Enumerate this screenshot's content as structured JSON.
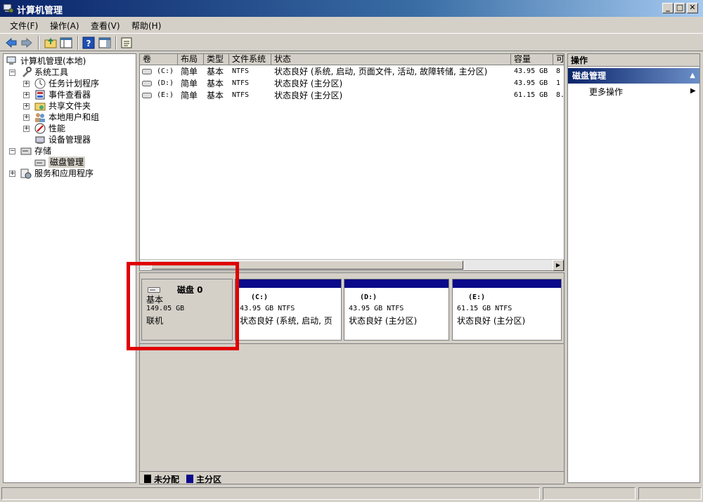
{
  "window": {
    "title": "计算机管理",
    "minimize": "_",
    "maximize": "□",
    "close": "✕"
  },
  "menu": [
    "文件(F)",
    "操作(A)",
    "查看(V)",
    "帮助(H)"
  ],
  "tree": [
    {
      "label": "计算机管理(本地)",
      "icon": "computer-icon"
    },
    {
      "label": "系统工具",
      "icon": "tools-icon",
      "expander": "−"
    },
    {
      "label": "任务计划程序",
      "icon": "clock-icon",
      "expander": "+"
    },
    {
      "label": "事件查看器",
      "icon": "event-viewer-icon",
      "expander": "+"
    },
    {
      "label": "共享文件夹",
      "icon": "shared-folder-icon",
      "expander": "+"
    },
    {
      "label": "本地用户和组",
      "icon": "users-icon",
      "expander": "+"
    },
    {
      "label": "性能",
      "icon": "performance-icon",
      "expander": "+"
    },
    {
      "label": "设备管理器",
      "icon": "device-manager-icon"
    },
    {
      "label": "存储",
      "icon": "storage-icon",
      "expander": "−"
    },
    {
      "label": "磁盘管理",
      "icon": "disk-management-icon",
      "selected": true
    },
    {
      "label": "服务和应用程序",
      "icon": "services-icon",
      "expander": "+"
    }
  ],
  "volume_columns": [
    "卷",
    "布局",
    "类型",
    "文件系统",
    "状态",
    "容量",
    "可"
  ],
  "volumes": [
    {
      "name": "(C:)",
      "layout": "简单",
      "type": "基本",
      "fs": "NTFS",
      "status": "状态良好 (系统, 启动, 页面文件, 活动, 故障转储, 主分区)",
      "capacity": "43.95 GB",
      "free": "8"
    },
    {
      "name": "(D:)",
      "layout": "简单",
      "type": "基本",
      "fs": "NTFS",
      "status": "状态良好 (主分区)",
      "capacity": "43.95 GB",
      "free": "1"
    },
    {
      "name": "(E:)",
      "layout": "简单",
      "type": "基本",
      "fs": "NTFS",
      "status": "状态良好 (主分区)",
      "capacity": "61.15 GB",
      "free": "8."
    }
  ],
  "disk": {
    "name": "磁盘 0",
    "type": "基本",
    "size": "149.05 GB",
    "state": "联机",
    "partitions": [
      {
        "name": "(C:)",
        "size": "43.95 GB NTFS",
        "status": "状态良好 (系统, 启动, 页"
      },
      {
        "name": "(D:)",
        "size": "43.95 GB NTFS",
        "status": "状态良好 (主分区)"
      },
      {
        "name": "(E:)",
        "size": "61.15 GB NTFS",
        "status": "状态良好 (主分区)"
      }
    ]
  },
  "legend": [
    {
      "label": "未分配",
      "color": "#000000"
    },
    {
      "label": "主分区",
      "color": "#0a0a8a"
    }
  ],
  "actions": {
    "header": "操作",
    "group": "磁盘管理",
    "collapse": "▲",
    "item": "更多操作",
    "arrow": "▶"
  },
  "colors": {
    "highlight": "#e00000",
    "partition_bar": "#0a0a8a"
  }
}
